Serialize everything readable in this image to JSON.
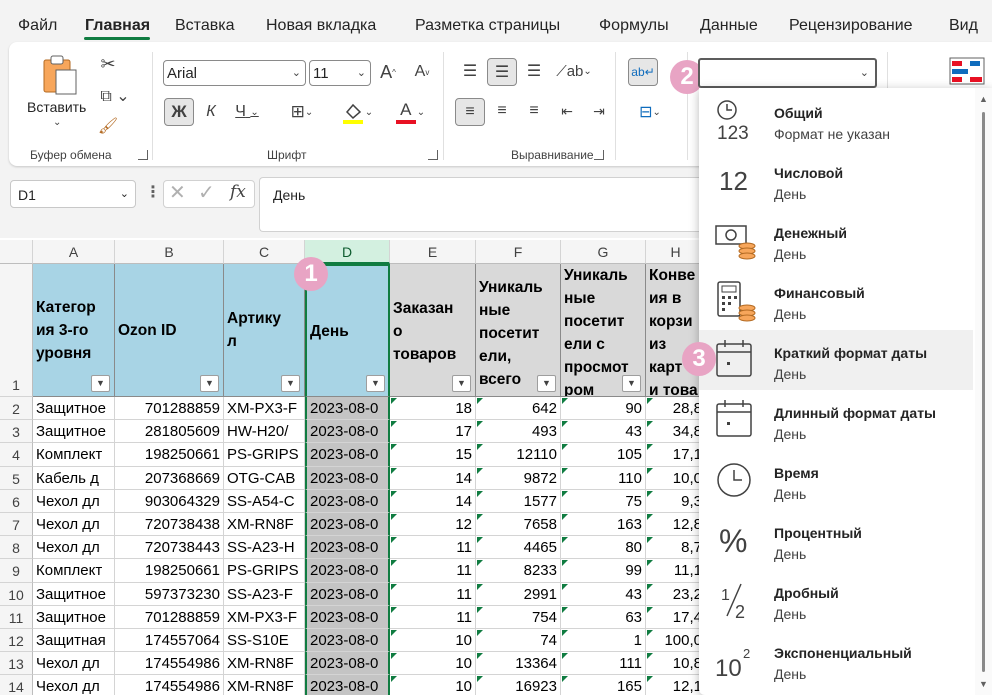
{
  "tabs": [
    "Файл",
    "Главная",
    "Вставка",
    "Новая вкладка",
    "Разметка страницы",
    "Формулы",
    "Данные",
    "Рецензирование",
    "Вид"
  ],
  "ribbon": {
    "paste_label": "Вставить",
    "groups": [
      "Буфер обмена",
      "Шрифт",
      "Выравнивание"
    ],
    "font_name": "Arial",
    "font_size": "11",
    "bold": "Ж",
    "italic": "К",
    "underline": "Ч",
    "font_grow": "A",
    "font_shrink": "A",
    "font_color_letter": "A",
    "number_format_value": ""
  },
  "formula_bar": {
    "name_box": "D1",
    "fx": "fx",
    "content": "День"
  },
  "sheet": {
    "columns": [
      "A",
      "B",
      "C",
      "D",
      "E",
      "F",
      "G",
      "H"
    ],
    "selected_column": "D",
    "header_row_number": "1",
    "headers": [
      [
        "Категор",
        "ия 3-го",
        "уровня"
      ],
      [
        "Ozon ID"
      ],
      [
        "Артику",
        "л"
      ],
      [
        "День"
      ],
      [
        "Заказан",
        "о",
        "товаров"
      ],
      [
        "Уникаль",
        "ные",
        "посетит",
        "ели,",
        "всего"
      ],
      [
        "Уникаль",
        "ные",
        "посетит",
        "ели с",
        "просмот",
        "ром"
      ],
      [
        "Конве",
        "ия в",
        "корзи",
        "из",
        "карт",
        "и това"
      ]
    ],
    "rows": [
      {
        "n": "2",
        "cells": [
          "Защитное",
          "701288859",
          "XM-PX3-F",
          "2023-08-0",
          "18",
          "642",
          "90",
          "28,8"
        ]
      },
      {
        "n": "3",
        "cells": [
          "Защитное",
          "281805609",
          "HW-H20/",
          "2023-08-0",
          "17",
          "493",
          "43",
          "34,8"
        ]
      },
      {
        "n": "4",
        "cells": [
          "Комплект",
          "198250661",
          "PS-GRIPS",
          "2023-08-0",
          "15",
          "12110",
          "105",
          "17,1"
        ]
      },
      {
        "n": "5",
        "cells": [
          "Кабель д",
          "207368669",
          "OTG-CAB",
          "2023-08-0",
          "14",
          "9872",
          "110",
          "10,0"
        ]
      },
      {
        "n": "6",
        "cells": [
          "Чехол дл",
          "903064329",
          "SS-A54-C",
          "2023-08-0",
          "14",
          "1577",
          "75",
          "9,3"
        ]
      },
      {
        "n": "7",
        "cells": [
          "Чехол дл",
          "720738438",
          "XM-RN8F",
          "2023-08-0",
          "12",
          "7658",
          "163",
          "12,8"
        ]
      },
      {
        "n": "8",
        "cells": [
          "Чехол дл",
          "720738443",
          "SS-A23-H",
          "2023-08-0",
          "11",
          "4465",
          "80",
          "8,7"
        ]
      },
      {
        "n": "9",
        "cells": [
          "Комплект",
          "198250661",
          "PS-GRIPS",
          "2023-08-0",
          "11",
          "8233",
          "99",
          "11,1"
        ]
      },
      {
        "n": "10",
        "cells": [
          "Защитное",
          "597373230",
          "SS-A23-F",
          "2023-08-0",
          "11",
          "2991",
          "43",
          "23,2"
        ]
      },
      {
        "n": "11",
        "cells": [
          "Защитное",
          "701288859",
          "XM-PX3-F",
          "2023-08-0",
          "11",
          "754",
          "63",
          "17,4"
        ]
      },
      {
        "n": "12",
        "cells": [
          "Защитная",
          "174557064",
          "SS-S10E",
          "2023-08-0",
          "10",
          "74",
          "1",
          "100,0"
        ]
      },
      {
        "n": "13",
        "cells": [
          "Чехол дл",
          "174554986",
          "XM-RN8F",
          "2023-08-0",
          "10",
          "13364",
          "111",
          "10,8"
        ]
      },
      {
        "n": "14",
        "cells": [
          "Чехол дл",
          "174554986",
          "XM-RN8F",
          "2023-08-0",
          "10",
          "16923",
          "165",
          "12,1"
        ]
      }
    ]
  },
  "format_menu": {
    "items": [
      {
        "title": "Общий",
        "sub": "Формат не указан",
        "icon": "clock-123-icon"
      },
      {
        "title": "Числовой",
        "sub": "День",
        "icon": "number-12-icon"
      },
      {
        "title": "Денежный",
        "sub": "День",
        "icon": "money-icon"
      },
      {
        "title": "Финансовый",
        "sub": " День",
        "icon": "calculator-icon"
      },
      {
        "title": "Краткий формат даты",
        "sub": "День",
        "icon": "short-date-calendar-icon"
      },
      {
        "title": "Длинный формат даты",
        "sub": "День",
        "icon": "long-date-calendar-icon"
      },
      {
        "title": "Время",
        "sub": "День",
        "icon": "clock-icon"
      },
      {
        "title": "Процентный",
        "sub": "День",
        "icon": "percent-icon"
      },
      {
        "title": "Дробный",
        "sub": "День",
        "icon": "fraction-icon"
      },
      {
        "title": "Экспоненциальный",
        "sub": "День",
        "icon": "exponent-icon"
      }
    ],
    "hovered_index": 4
  },
  "badges": [
    "1",
    "2",
    "3"
  ],
  "colors": {
    "accent_green": "#107c41",
    "header_blue": "#a8d4e5",
    "header_gray": "#d9d9d9",
    "badge_pink": "#e8a4c4",
    "highlight_yellow": "#ffff00",
    "font_red": "#e81123"
  }
}
